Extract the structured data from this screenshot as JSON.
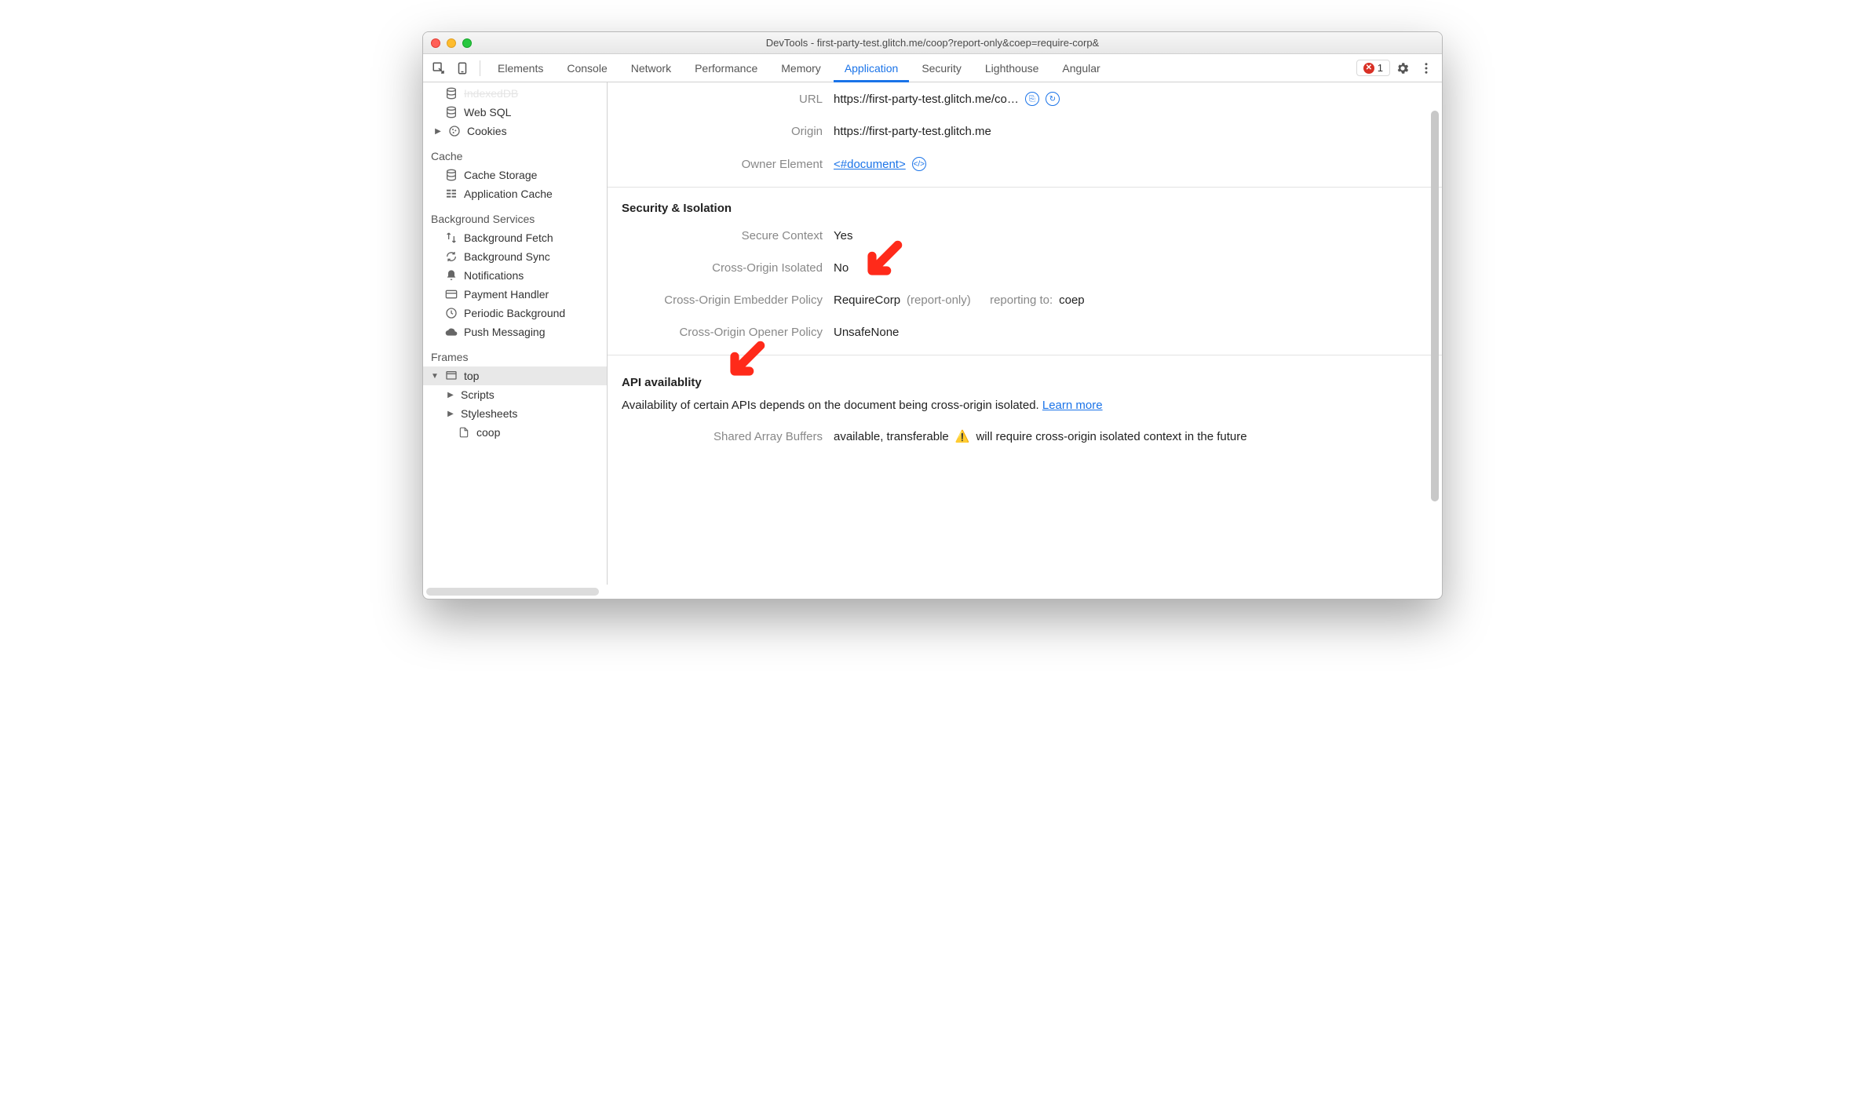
{
  "window": {
    "title": "DevTools - first-party-test.glitch.me/coop?report-only&coep=require-corp&"
  },
  "toolbar": {
    "tabs": [
      "Elements",
      "Console",
      "Network",
      "Performance",
      "Memory",
      "Application",
      "Security",
      "Lighthouse",
      "Angular"
    ],
    "active_tab": "Application",
    "error_count": "1"
  },
  "sidebar": {
    "storage": {
      "indexeddb": "IndexedDB",
      "websql": "Web SQL",
      "cookies": "Cookies"
    },
    "cache": {
      "title": "Cache",
      "items": [
        "Cache Storage",
        "Application Cache"
      ]
    },
    "background": {
      "title": "Background Services",
      "items": [
        "Background Fetch",
        "Background Sync",
        "Notifications",
        "Payment Handler",
        "Periodic Background",
        "Push Messaging"
      ]
    },
    "frames": {
      "title": "Frames",
      "top": "top",
      "children": [
        "Scripts",
        "Stylesheets",
        "coop"
      ]
    }
  },
  "details": {
    "url_label": "URL",
    "url_value": "https://first-party-test.glitch.me/co…",
    "origin_label": "Origin",
    "origin_value": "https://first-party-test.glitch.me",
    "owner_label": "Owner Element",
    "owner_value": "<#document>",
    "security_title": "Security & Isolation",
    "secure_ctx_label": "Secure Context",
    "secure_ctx_value": "Yes",
    "coi_label": "Cross-Origin Isolated",
    "coi_value": "No",
    "coep_label": "Cross-Origin Embedder Policy",
    "coep_value": "RequireCorp",
    "coep_mode": "(report-only)",
    "coep_reporting_label": "reporting to:",
    "coep_reporting_value": "coep",
    "coop_label": "Cross-Origin Opener Policy",
    "coop_value": "UnsafeNone",
    "api_title": "API availablity",
    "api_desc": "Availability of certain APIs depends on the document being cross-origin isolated. ",
    "api_learn": "Learn more",
    "sab_label": "Shared Array Buffers",
    "sab_value": "available, transferable",
    "sab_warn": "will require cross-origin isolated context in the future"
  }
}
